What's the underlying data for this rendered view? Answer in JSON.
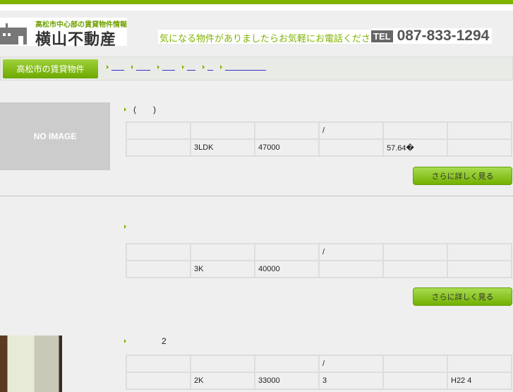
{
  "header": {
    "subtitle": "高松市中心部の賃貸物件情報",
    "company": "横山不動産",
    "tagline": "気になる物件がありましたらお気軽にお電話ください。",
    "tel_label": "TEL",
    "tel_number": "087-833-1294"
  },
  "nav": {
    "button": "高松市の賃貸物件",
    "crumbs": [
      "",
      "",
      "",
      "",
      "",
      ""
    ]
  },
  "listings": [
    {
      "image": "NO IMAGE",
      "title": "(　　)",
      "header_row": [
        "",
        "",
        "",
        "/",
        "",
        ""
      ],
      "row": [
        "",
        "3LDK",
        "47000",
        "",
        "57.64�",
        ""
      ],
      "more": "さらに詳しく見る"
    },
    {
      "image": "",
      "title": "",
      "header_row": [
        "",
        "",
        "",
        "/",
        "",
        ""
      ],
      "row": [
        "",
        "3K",
        "40000",
        "",
        "",
        ""
      ],
      "more": "さらに詳しく見る"
    },
    {
      "image": "photo",
      "title": "2",
      "header_row": [
        "",
        "",
        "",
        "/",
        "",
        ""
      ],
      "row": [
        "",
        "2K",
        "33000",
        "3",
        "",
        "H22 4"
      ]
    }
  ]
}
